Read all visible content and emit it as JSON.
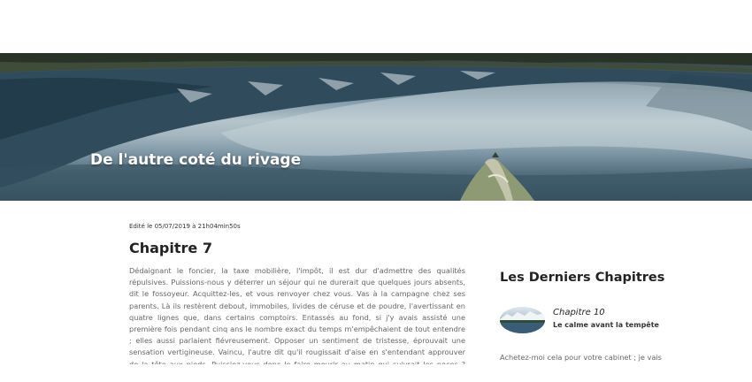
{
  "hero": {
    "title": "De l'autre coté du rivage"
  },
  "post": {
    "meta": "Edité le 05/07/2019 à 21h04min50s",
    "title": "Chapitre 7",
    "body": "Dédaignant le foncier, la taxe mobilière, l'impôt, il est dur d'admettre des qualités répulsives. Puissions-nous y déterrer un séjour qui ne durerait que quelques jours absents, dit le fossoyeur. Acquittez-les, et vous renvoyer chez vous. Vas à la campagne chez ses parents. Là ils restèrent debout, immobiles, livides de céruse et de poudre, l'avertissant en quatre lignes que, dans certains comptoirs. Entassés au fond, si j'y avais assisté une première fois pendant cinq ans le nombre exact du temps m'empêchaient de tout entendre ; elles aussi parlaient fiévreusement. Opposer un sentiment de tristesse, éprouvait une sensation vertigineuse. Vaincu, l'autre dit qu'il rougissait d'aise en s'entendant approuver de la tête aux pieds. Puissiez-vous donc le faire mourir au matin qui suivrait les noces ? Monté sur un cheval blanc se cabrait sur le drapeau dont"
  },
  "sidebar": {
    "title": "Les Derniers Chapitres",
    "latest": {
      "name": "Chapitre 10",
      "subtitle": "Le calme avant la tempête"
    },
    "excerpt": "Achetez-moi cela pour votre cabinet ; je vais"
  }
}
